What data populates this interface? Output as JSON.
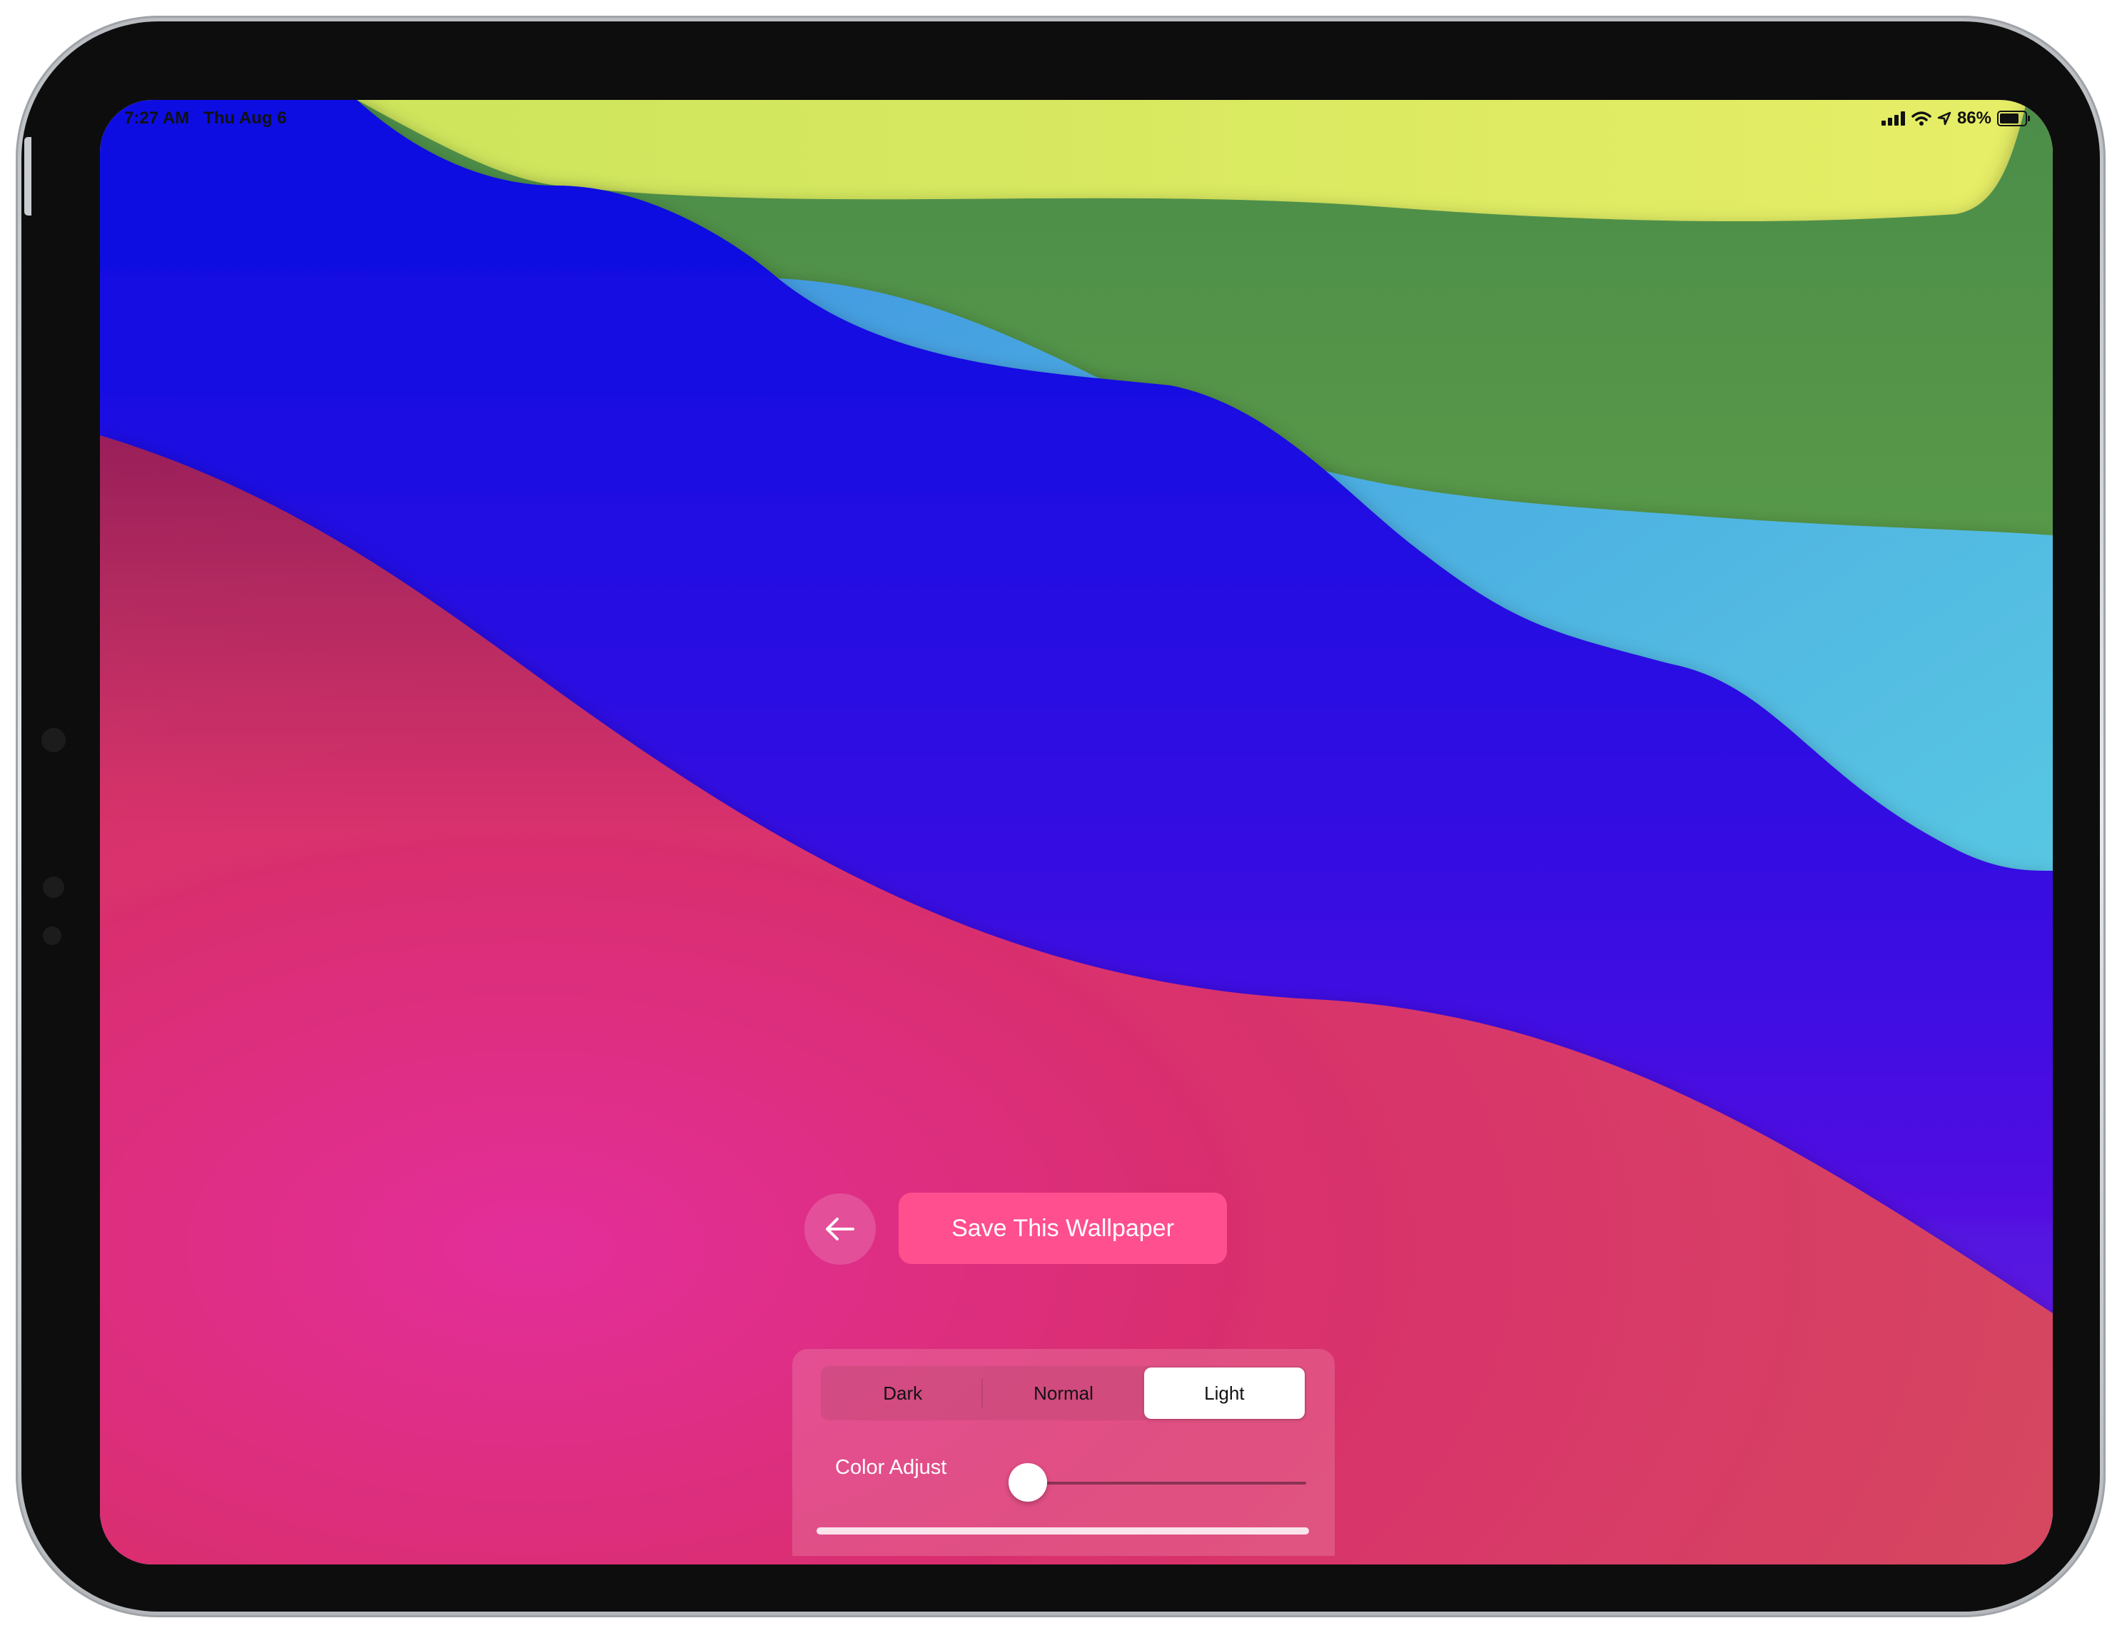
{
  "status_bar": {
    "time": "7:27 AM",
    "date": "Thu Aug 6",
    "battery_percent": "86%",
    "battery_level": 0.86
  },
  "actions": {
    "back_icon": "arrow-left-icon",
    "save_label": "Save This Wallpaper"
  },
  "appearance": {
    "options": [
      "Dark",
      "Normal",
      "Light"
    ],
    "selected": "Light"
  },
  "color_adjust": {
    "label": "Color Adjust",
    "value": 0.0
  },
  "colors": {
    "accent": "#ff4f8e",
    "wallpaper_bands": [
      "#e1ec62",
      "#5e9c4a",
      "#56bfe6",
      "#2a07e0",
      "#d6356b"
    ]
  }
}
